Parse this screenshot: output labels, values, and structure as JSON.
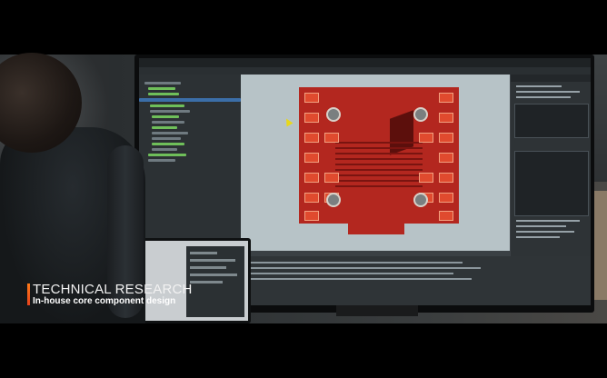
{
  "caption": {
    "title": "TECHNICAL RESEARCH",
    "subtitle": "In-house core component design"
  },
  "colors": {
    "accent": "#ff7a18",
    "pcb_copper": "#b3271f",
    "pcb_pad": "#e04a2e",
    "canvas_bg": "#b7c3c7"
  },
  "icons": [
    "mouse-cursor-icon"
  ]
}
